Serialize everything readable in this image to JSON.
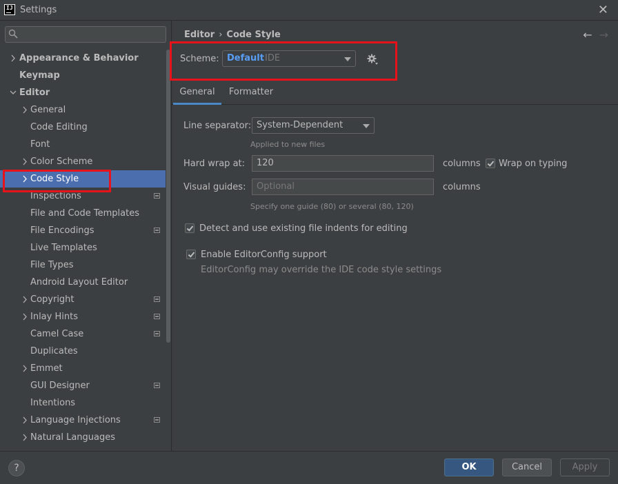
{
  "window": {
    "title": "Settings",
    "app_icon_text": "IJ"
  },
  "sidebar": {
    "search_placeholder": "",
    "items": [
      {
        "label": "Appearance & Behavior",
        "level": 0,
        "chevron": "right",
        "bold": true
      },
      {
        "label": "Keymap",
        "level": 0,
        "chevron": "none",
        "bold": true
      },
      {
        "label": "Editor",
        "level": 0,
        "chevron": "down",
        "bold": true
      },
      {
        "label": "General",
        "level": 1,
        "chevron": "right"
      },
      {
        "label": "Code Editing",
        "level": 1,
        "chevron": "none"
      },
      {
        "label": "Font",
        "level": 1,
        "chevron": "none"
      },
      {
        "label": "Color Scheme",
        "level": 1,
        "chevron": "right"
      },
      {
        "label": "Code Style",
        "level": 1,
        "chevron": "right",
        "selected": true
      },
      {
        "label": "Inspections",
        "level": 1,
        "chevron": "none",
        "project_icon": true
      },
      {
        "label": "File and Code Templates",
        "level": 1,
        "chevron": "none"
      },
      {
        "label": "File Encodings",
        "level": 1,
        "chevron": "none",
        "project_icon": true
      },
      {
        "label": "Live Templates",
        "level": 1,
        "chevron": "none"
      },
      {
        "label": "File Types",
        "level": 1,
        "chevron": "none"
      },
      {
        "label": "Android Layout Editor",
        "level": 1,
        "chevron": "none"
      },
      {
        "label": "Copyright",
        "level": 1,
        "chevron": "right",
        "project_icon": true
      },
      {
        "label": "Inlay Hints",
        "level": 1,
        "chevron": "right",
        "project_icon": true
      },
      {
        "label": "Camel Case",
        "level": 1,
        "chevron": "none",
        "project_icon": true
      },
      {
        "label": "Duplicates",
        "level": 1,
        "chevron": "none"
      },
      {
        "label": "Emmet",
        "level": 1,
        "chevron": "right"
      },
      {
        "label": "GUI Designer",
        "level": 1,
        "chevron": "none",
        "project_icon": true
      },
      {
        "label": "Intentions",
        "level": 1,
        "chevron": "none"
      },
      {
        "label": "Language Injections",
        "level": 1,
        "chevron": "right",
        "project_icon": true
      },
      {
        "label": "Natural Languages",
        "level": 1,
        "chevron": "right"
      }
    ]
  },
  "content": {
    "breadcrumb": {
      "parent": "Editor",
      "separator": "›",
      "current": "Code Style"
    },
    "nav": {
      "back": "←",
      "forward": "→"
    },
    "scheme": {
      "label": "Scheme:",
      "name": "Default",
      "type": "IDE"
    },
    "tabs": [
      {
        "label": "General",
        "active": true
      },
      {
        "label": "Formatter",
        "active": false
      }
    ],
    "line_separator": {
      "label": "Line separator:",
      "value": "System-Dependent",
      "hint": "Applied to new files"
    },
    "hard_wrap": {
      "label": "Hard wrap at:",
      "value": "120",
      "unit": "columns",
      "wrap_on_typing_label": "Wrap on typing",
      "wrap_on_typing_checked": true
    },
    "visual_guides": {
      "label": "Visual guides:",
      "placeholder": "Optional",
      "unit": "columns",
      "hint": "Specify one guide (80) or several (80, 120)"
    },
    "detect_indents": {
      "label": "Detect and use existing file indents for editing",
      "checked": true
    },
    "editorconfig": {
      "label": "Enable EditorConfig support",
      "checked": true,
      "note": "EditorConfig may override the IDE code style settings"
    }
  },
  "footer": {
    "help": "?",
    "ok": "OK",
    "cancel": "Cancel",
    "apply": "Apply"
  },
  "colors": {
    "background": "#3c3f41",
    "selection": "#4b6eaf",
    "accent_blue": "#589df6",
    "primary_button": "#365880",
    "highlight_red": "#e8131a"
  }
}
